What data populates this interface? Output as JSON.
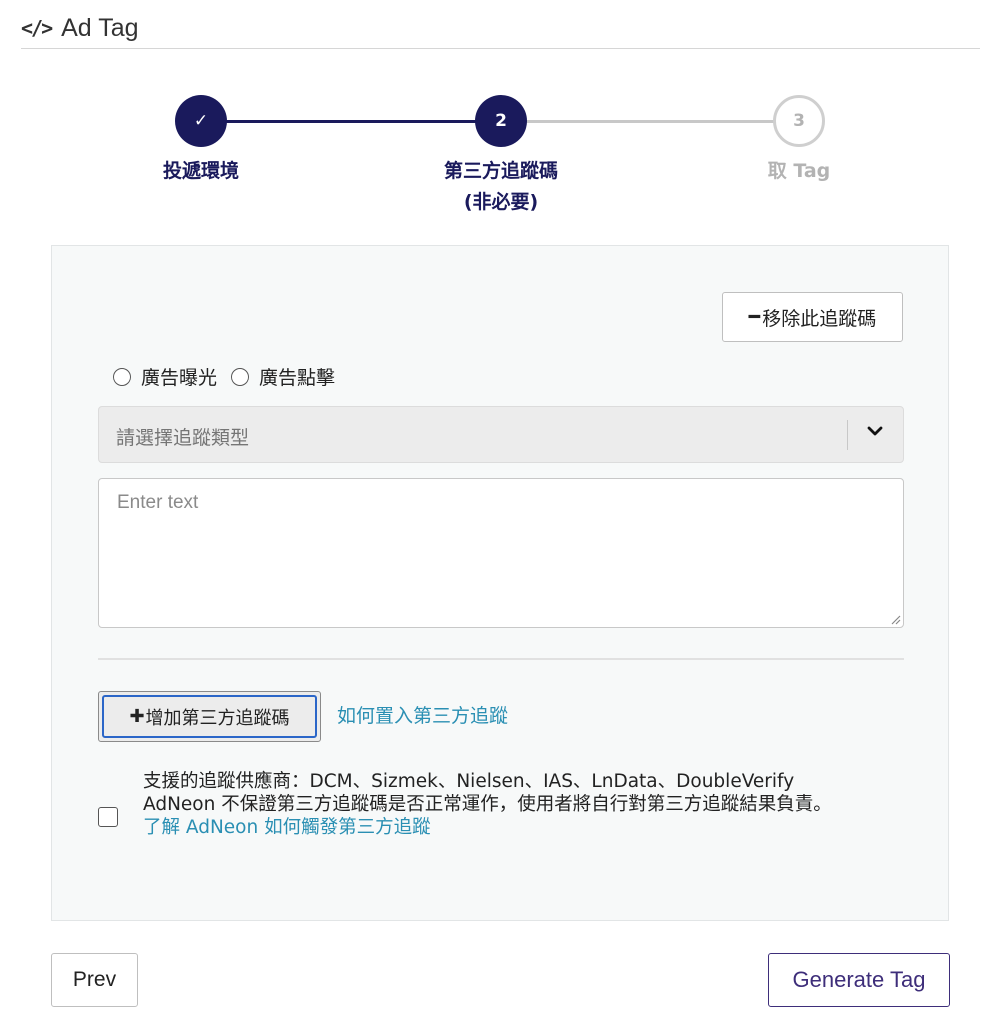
{
  "header": {
    "icon": "code-icon",
    "icon_glyph": "</>",
    "title": "Ad Tag"
  },
  "stepper": {
    "steps": [
      {
        "number": "",
        "glyph": "✓",
        "label": "投遞環境",
        "status": "completed"
      },
      {
        "number": "2",
        "label": "第三方追蹤碼",
        "sublabel": "(非必要)",
        "status": "active"
      },
      {
        "number": "3",
        "label": "取 Tag",
        "status": "pending"
      }
    ],
    "colors": {
      "active": "#1a1a5c",
      "pending": "#c8c8c8",
      "pending_text": "#b3b3b3"
    }
  },
  "tracker": {
    "remove_button": {
      "icon": "minus-icon",
      "label": "移除此追蹤碼"
    },
    "radio_options": [
      "廣告曝光",
      "廣告點擊"
    ],
    "type_select": {
      "placeholder": "請選擇追蹤類型",
      "icon": "chevron-down-icon"
    },
    "code_input": {
      "placeholder": "Enter text",
      "value": ""
    }
  },
  "add_tracker": {
    "button_icon": "plus-icon",
    "button_label": "增加第三方追蹤碼",
    "help_link": "如何置入第三方追蹤"
  },
  "notice": {
    "checked": false,
    "vendors": "支援的追蹤供應商：DCM、Sizmek、Nielsen、IAS、LnData、DoubleVerify",
    "disclaimer": "AdNeon 不保證第三方追蹤碼是否正常運作，使用者將自行對第三方追蹤結果負責。",
    "learn_link": "了解 AdNeon 如何觸發第三方追蹤",
    "link_color": "#2a8fb3"
  },
  "footer": {
    "prev_label": "Prev",
    "generate_label": "Generate Tag",
    "generate_color": "#3e2e7a"
  }
}
